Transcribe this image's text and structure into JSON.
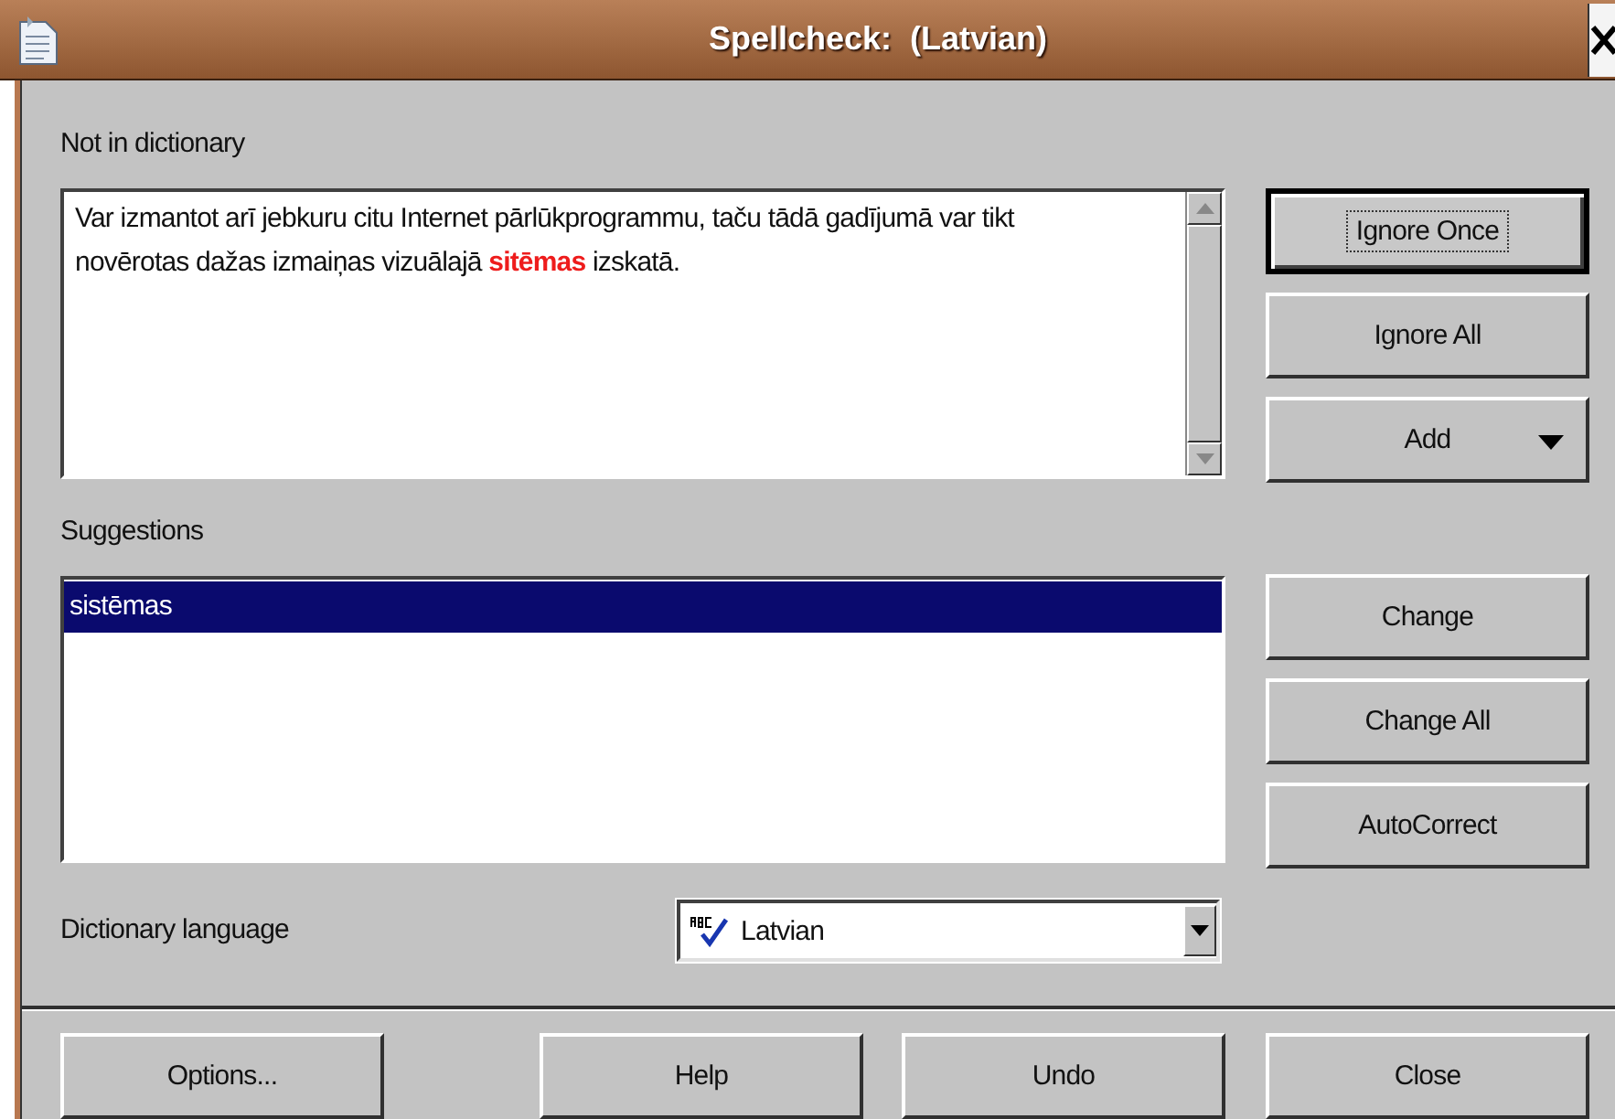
{
  "window": {
    "title": "Spellcheck:  (Latvian)"
  },
  "not_in_dictionary": {
    "label": "Not in dictionary",
    "segments": [
      {
        "kind": "plain",
        "text": "Var izmantot arī jebkuru citu Internet pārlūkprogrammu, taču tādā gadījumā var tikt novērotas dažas izmaiņas vizuālajā "
      },
      {
        "kind": "error",
        "text": "sitēmas"
      },
      {
        "kind": "plain",
        "text": " izskatā."
      }
    ]
  },
  "side_buttons": [
    {
      "label": "Ignore Once",
      "kind": "plain",
      "focused": true
    },
    {
      "label": "Ignore All",
      "kind": "plain",
      "focused": false
    },
    {
      "label": "Add",
      "kind": "menu",
      "focused": false
    },
    {
      "label": "Change",
      "kind": "plain",
      "focused": false
    },
    {
      "label": "Change All",
      "kind": "plain",
      "focused": false
    },
    {
      "label": "AutoCorrect",
      "kind": "plain",
      "focused": false
    }
  ],
  "suggestions": {
    "label": "Suggestions",
    "items": [
      {
        "text": "sistēmas",
        "selected": true
      }
    ]
  },
  "dictionary_language": {
    "label": "Dictionary language",
    "value": "Latvian"
  },
  "bottom_buttons": [
    {
      "label": "Options..."
    },
    {
      "label": "Help"
    },
    {
      "label": "Undo"
    },
    {
      "label": "Close"
    }
  ]
}
